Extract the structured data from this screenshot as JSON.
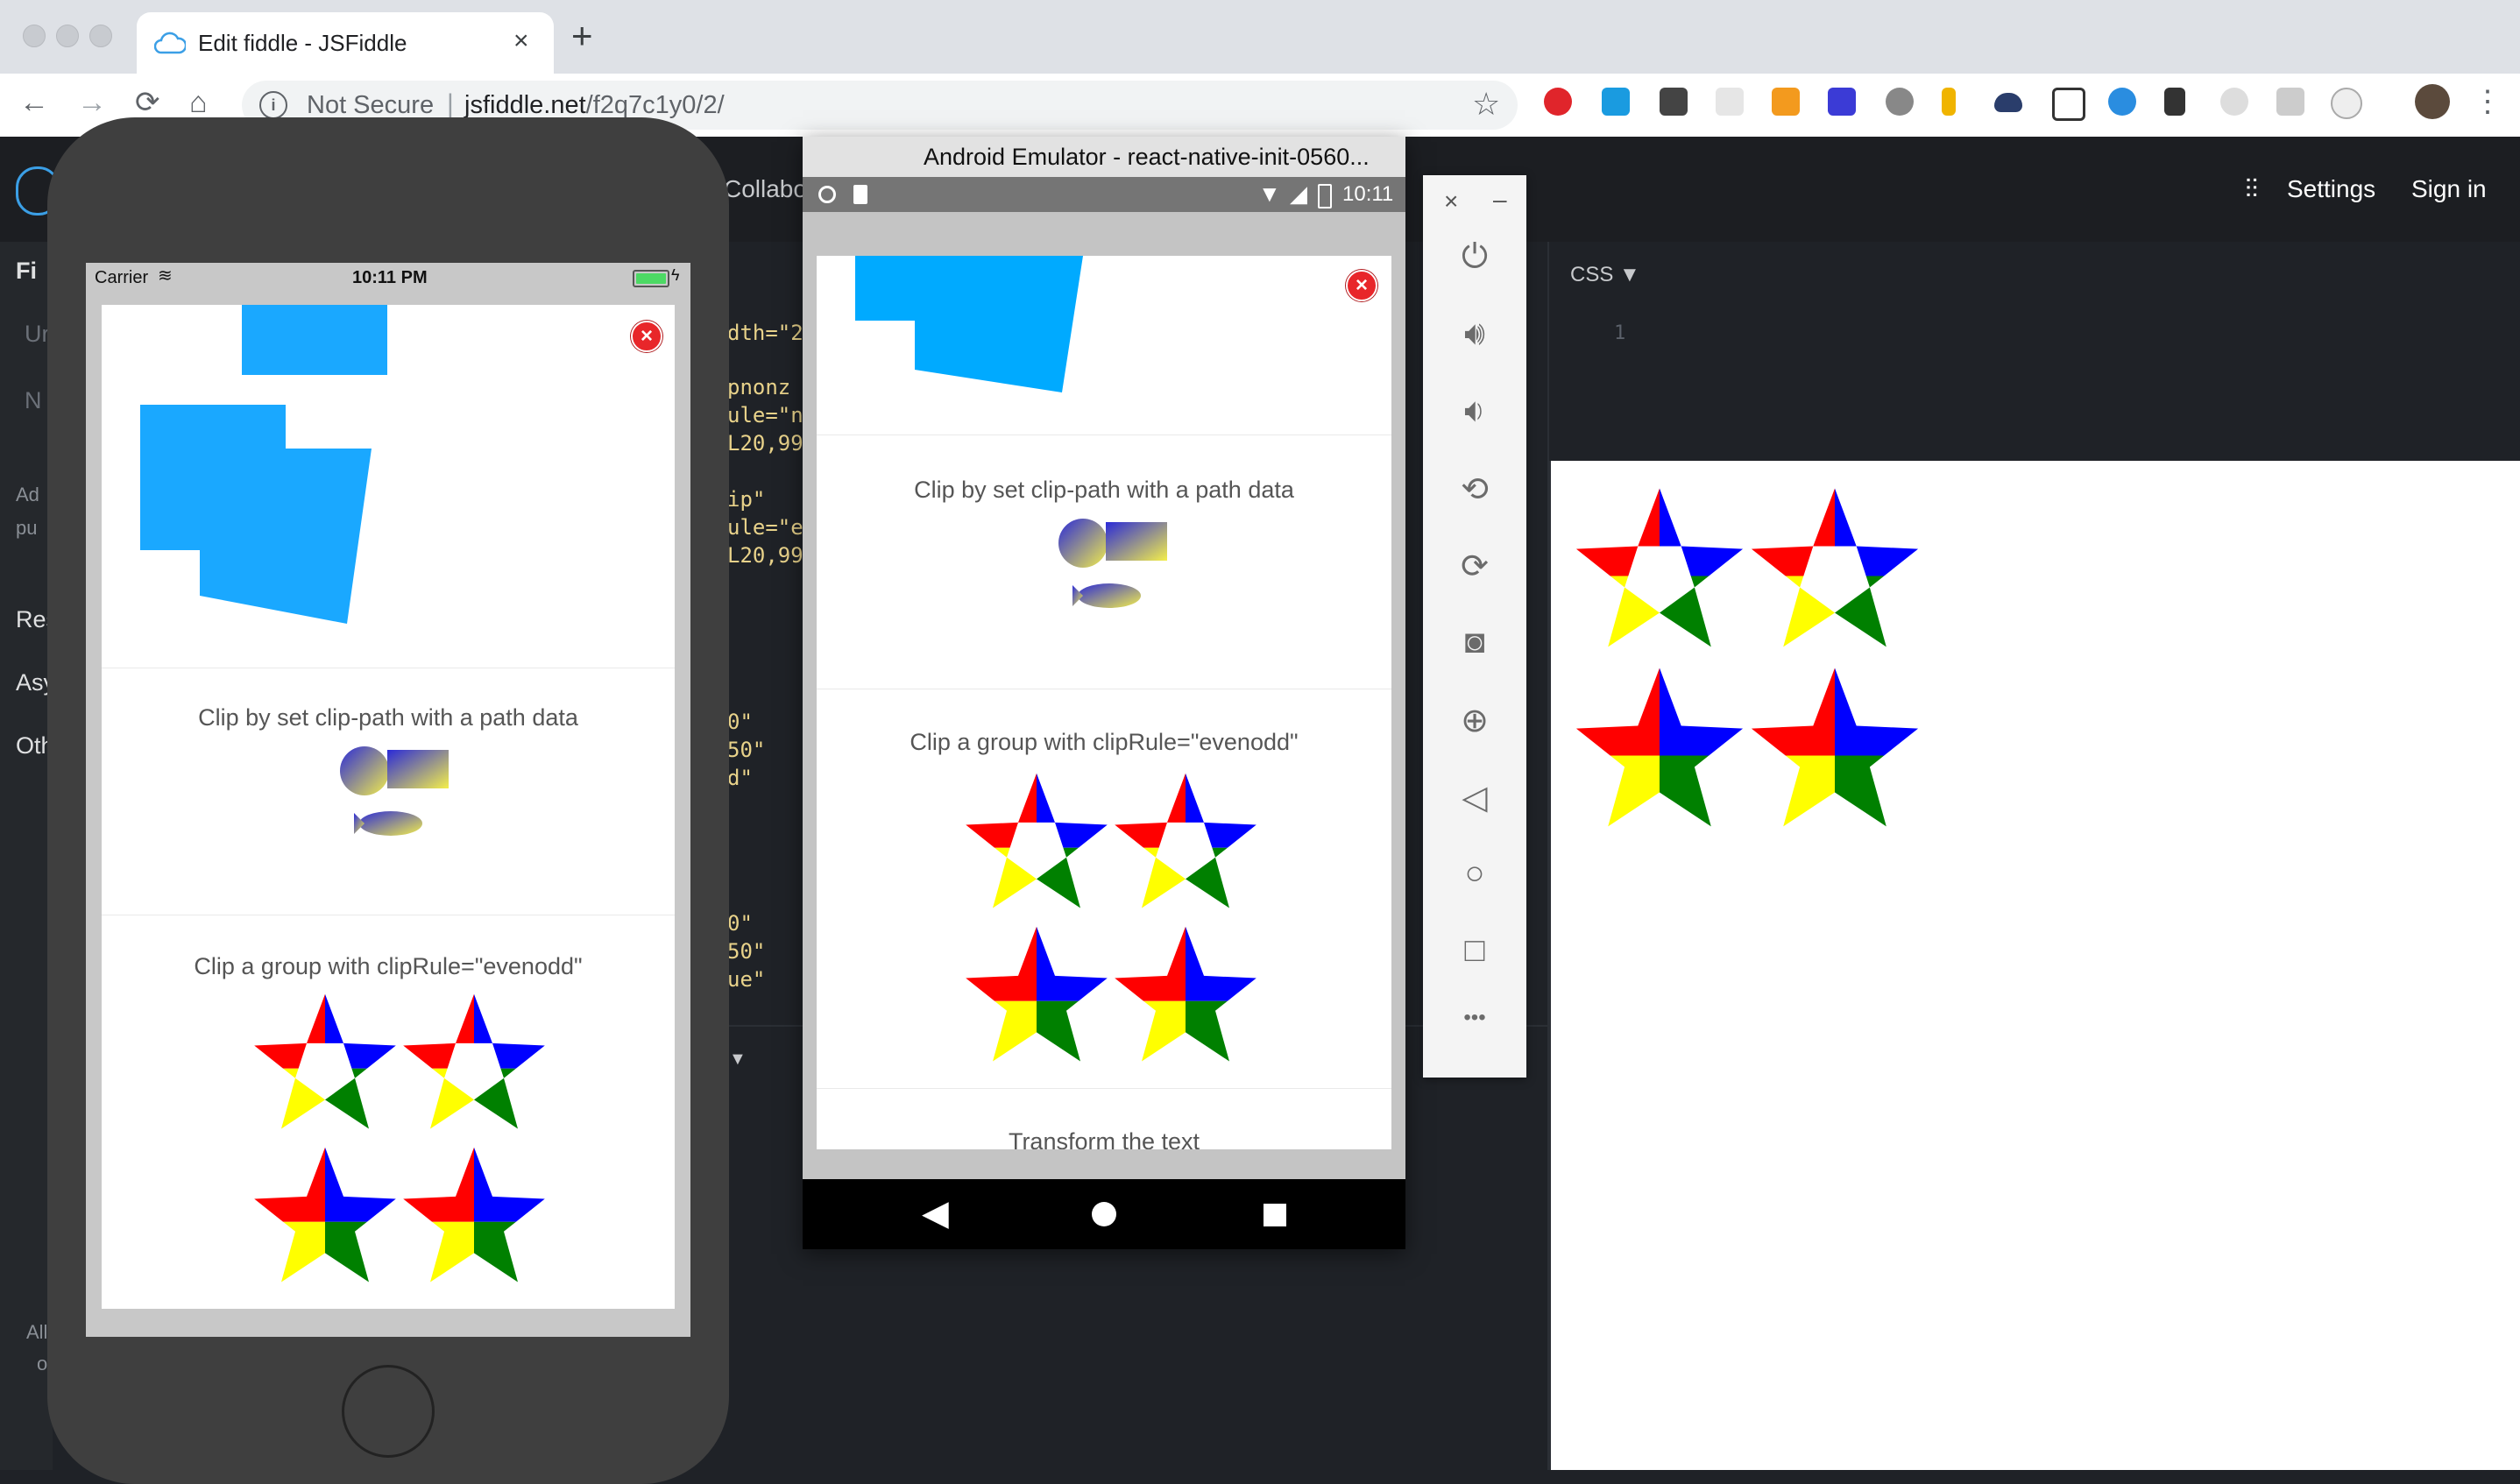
{
  "browser": {
    "tab_title": "Edit fiddle - JSFiddle",
    "tab_close": "×",
    "new_tab": "+",
    "back": "←",
    "forward": "→",
    "reload": "⟳",
    "home": "⌂",
    "security_label": "Not Secure",
    "url_host": "jsfiddle.net",
    "url_path": "/f2q7c1y0/2/",
    "bookmark": "☆",
    "menu": "⋮"
  },
  "jsfiddle": {
    "collab_label": "Collabo",
    "settings_label": "Settings",
    "signin_label": "Sign in",
    "left_labels": [
      "Fi",
      "Ur",
      "N",
      "Ad",
      "pu",
      "Res",
      "Asy",
      "Oth",
      "All",
      "o"
    ],
    "code_lines": [
      "dth=\"2",
      "pnonz",
      "ule=\"n",
      "L20,99",
      "ip\"",
      "ule=\"e",
      "L20,99",
      "0\"",
      "50\"",
      "d\"",
      "0\"",
      "50\"",
      "ue\""
    ],
    "css_label": "CSS ▼",
    "css_line_number": "1",
    "collapse_arrow": "▼"
  },
  "ios": {
    "carrier": "Carrier",
    "time": "10:11 PM",
    "demo_clip_path_title": "Clip by set clip-path with a path data",
    "demo_clip_group_title": "Clip a group with clipRule=\"evenodd\"",
    "close_glyph": "×"
  },
  "android": {
    "window_title": "Android Emulator - react-native-init-0560...",
    "status_time": "10:11",
    "demo_clip_path_title": "Clip by set clip-path with a path data",
    "demo_clip_group_title": "Clip a group with clipRule=\"evenodd\"",
    "demo_transform_title": "Transform the text",
    "close_glyph": "×"
  },
  "emulator_panel": {
    "close": "×",
    "minimize": "–",
    "more": "•••"
  },
  "colors": {
    "star_red": "#ff0000",
    "star_blue": "#0000ff",
    "star_yellow": "#ffff00",
    "star_green": "#008000",
    "clip_blue": "#1aa8ff"
  }
}
